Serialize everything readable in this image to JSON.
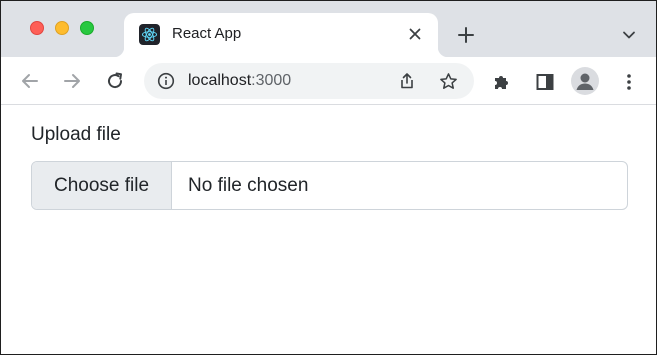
{
  "browser": {
    "tab": {
      "title": "React App",
      "favicon": "react-logo-icon",
      "close_icon": "close-icon"
    },
    "new_tab_icon": "plus-icon",
    "tab_search_icon": "chevron-down-icon",
    "toolbar": {
      "back_icon": "arrow-left-icon",
      "forward_icon": "arrow-right-icon",
      "reload_icon": "reload-icon",
      "omnibox": {
        "info_icon": "info-icon",
        "host": "localhost",
        "port": ":3000",
        "share_icon": "share-icon",
        "bookmark_icon": "star-icon"
      },
      "extensions_icon": "puzzle-icon",
      "side_panel_icon": "side-panel-icon",
      "profile_icon": "person-icon",
      "menu_icon": "kebab-menu-icon"
    },
    "traffic_lights": {
      "close": "#fe5f57",
      "minimize": "#febc2e",
      "maximize": "#28c840"
    }
  },
  "page": {
    "label": "Upload file",
    "file_input": {
      "button_label": "Choose file",
      "status": "No file chosen"
    }
  }
}
